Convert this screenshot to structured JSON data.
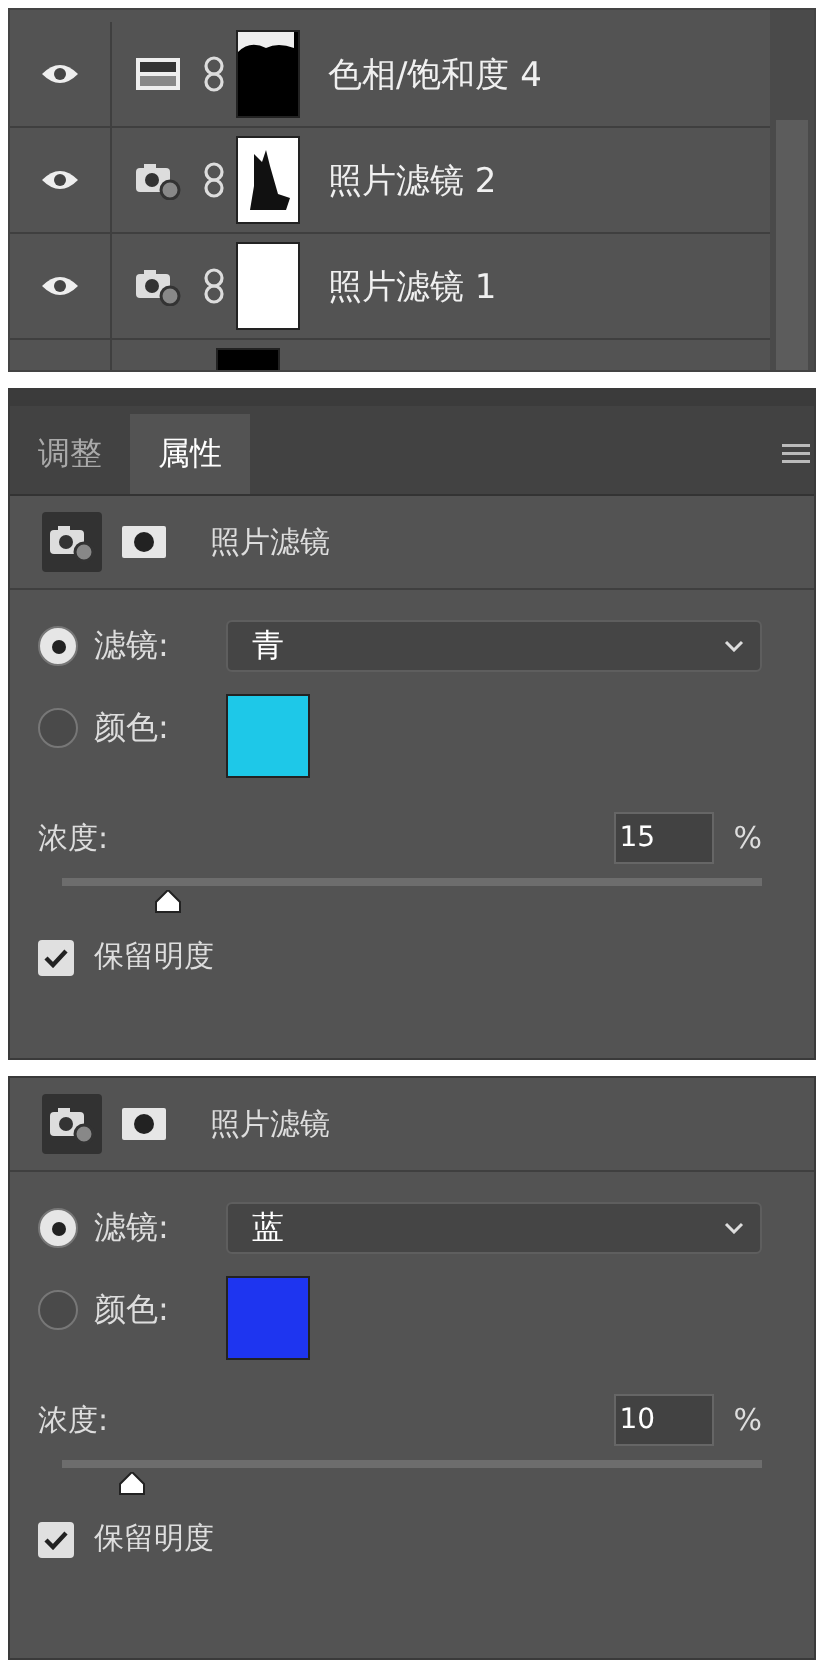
{
  "layers": [
    {
      "visible": true,
      "kind": "hue_saturation",
      "mask": {
        "kind": "top_dark"
      },
      "name": "色相/饱和度 4"
    },
    {
      "visible": true,
      "kind": "photo_filter",
      "mask": {
        "kind": "figure"
      },
      "name": "照片滤镜 2"
    },
    {
      "visible": true,
      "kind": "photo_filter",
      "mask": {
        "kind": "white"
      },
      "name": "照片滤镜 1"
    },
    {
      "kind": "none",
      "mask": {
        "kind": "dark"
      }
    }
  ],
  "panels": [
    {
      "tabs": [
        {
          "label": "调整",
          "selected": false
        },
        {
          "label": "属性",
          "selected": true
        }
      ],
      "header": {
        "title": "照片滤镜",
        "adjustment_selected": true
      },
      "filter": {
        "selected": true,
        "label": "滤镜:",
        "value": "青"
      },
      "color": {
        "selected": false,
        "label": "颜色:",
        "color": "#1ec8e8"
      },
      "density": {
        "label": "浓度:",
        "value": "15",
        "unit": "%",
        "level": 0.15
      },
      "preserve": {
        "label": "保留明度",
        "checked": true
      }
    },
    {
      "header": {
        "title": "照片滤镜",
        "adjustment_selected": true
      },
      "filter": {
        "selected": true,
        "label": "滤镜:",
        "value": "蓝"
      },
      "color": {
        "selected": false,
        "label": "颜色:",
        "color": "#1e35f0"
      },
      "density": {
        "label": "浓度:",
        "value": "10",
        "unit": "%",
        "level": 0.1
      },
      "preserve": {
        "label": "保留明度",
        "checked": true
      }
    }
  ]
}
